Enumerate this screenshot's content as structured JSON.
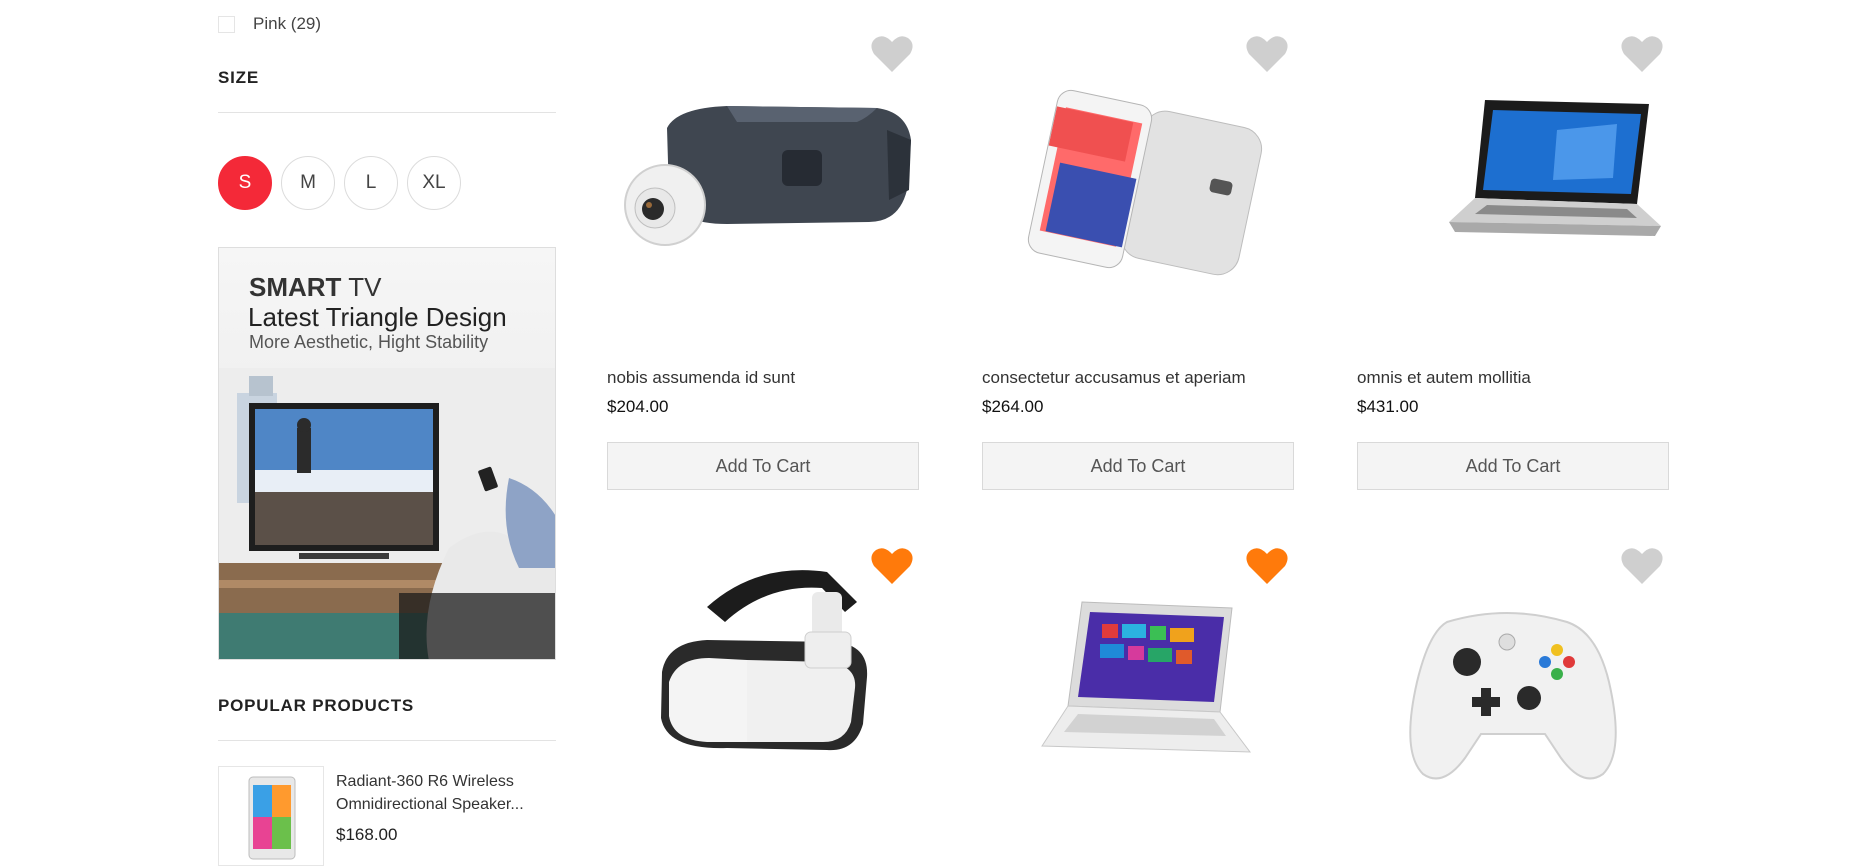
{
  "filters": {
    "color_option": {
      "label": "Pink (29)",
      "checked": false
    },
    "size_title": "SIZE",
    "sizes": [
      {
        "label": "S",
        "active": true
      },
      {
        "label": "M",
        "active": false
      },
      {
        "label": "L",
        "active": false
      },
      {
        "label": "XL",
        "active": false
      }
    ]
  },
  "banner": {
    "line1_bold": "SMART",
    "line1_rest": " TV",
    "line2": "Latest Triangle Design",
    "line3": "More Aesthetic, Hight Stability"
  },
  "popular": {
    "title": "POPULAR PRODUCTS",
    "items": [
      {
        "name": "Radiant-360 R6 Wireless Omnidirectional Speaker...",
        "price": "$168.00",
        "icon": "tablet-thumbnail"
      }
    ]
  },
  "products": [
    {
      "name": "nobis assumenda id sunt",
      "price": "$204.00",
      "cta": "Add To Cart",
      "wishlisted": false,
      "image": "vr-headset-camera"
    },
    {
      "name": "consectetur accusamus et aperiam",
      "price": "$264.00",
      "cta": "Add To Cart",
      "wishlisted": false,
      "image": "smartphone"
    },
    {
      "name": "omnis et autem mollitia",
      "price": "$431.00",
      "cta": "Add To Cart",
      "wishlisted": false,
      "image": "laptop"
    },
    {
      "name": "",
      "price": "",
      "cta": "",
      "wishlisted": true,
      "image": "vr-glasses"
    },
    {
      "name": "",
      "price": "",
      "cta": "",
      "wishlisted": true,
      "image": "ultrabook"
    },
    {
      "name": "",
      "price": "",
      "cta": "",
      "wishlisted": false,
      "image": "game-controller"
    }
  ],
  "colors": {
    "accent_red": "#f42938",
    "heart_active": "#ff7a0b",
    "heart_inactive": "#cfcfcf"
  }
}
